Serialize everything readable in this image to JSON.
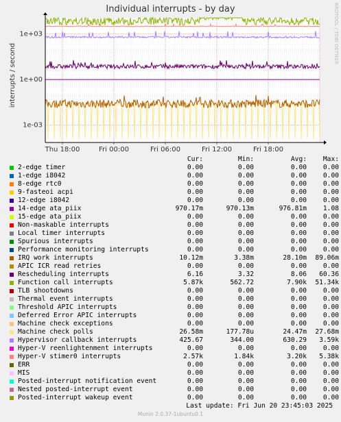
{
  "chart_data": {
    "type": "line",
    "title": "Individual interrupts - by day",
    "ylabel": "interrupts / second",
    "yscale": "log",
    "yticks": [
      "1e+03",
      "1e+00",
      "1e-03"
    ],
    "xticks": [
      "Thu 18:00",
      "Fri 00:00",
      "Fri 06:00",
      "Fri 12:00",
      "Fri 18:00"
    ],
    "grid": true,
    "columns": [
      "Cur:",
      "Min:",
      "Avg:",
      "Max:"
    ],
    "series": [
      {
        "name": "2-edge      timer",
        "color": "#00cc00",
        "cur": "0.00",
        "min": "0.00",
        "avg": "0.00",
        "max": "0.00"
      },
      {
        "name": "1-edge      i8042",
        "color": "#0066b3",
        "cur": "0.00",
        "min": "0.00",
        "avg": "0.00",
        "max": "0.00"
      },
      {
        "name": "8-edge      rtc0",
        "color": "#ff8000",
        "cur": "0.00",
        "min": "0.00",
        "avg": "0.00",
        "max": "0.00"
      },
      {
        "name": "9-fasteoi   acpi",
        "color": "#ffcc00",
        "cur": "0.00",
        "min": "0.00",
        "avg": "0.00",
        "max": "0.00"
      },
      {
        "name": "12-edge      i8042",
        "color": "#330099",
        "cur": "0.00",
        "min": "0.00",
        "avg": "0.00",
        "max": "0.00"
      },
      {
        "name": "14-edge      ata_piix",
        "color": "#990099",
        "cur": "970.17m",
        "min": "970.13m",
        "avg": "976.81m",
        "max": "1.08"
      },
      {
        "name": "15-edge      ata_piix",
        "color": "#ccff00",
        "cur": "0.00",
        "min": "0.00",
        "avg": "0.00",
        "max": "0.00"
      },
      {
        "name": "Non-maskable interrupts",
        "color": "#ff0000",
        "cur": "0.00",
        "min": "0.00",
        "avg": "0.00",
        "max": "0.00"
      },
      {
        "name": "Local timer interrupts",
        "color": "#808080",
        "cur": "0.00",
        "min": "0.00",
        "avg": "0.00",
        "max": "0.00"
      },
      {
        "name": "Spurious interrupts",
        "color": "#008f00",
        "cur": "0.00",
        "min": "0.00",
        "avg": "0.00",
        "max": "0.00"
      },
      {
        "name": "Performance monitoring interrupts",
        "color": "#00487d",
        "cur": "0.00",
        "min": "0.00",
        "avg": "0.00",
        "max": "0.00"
      },
      {
        "name": "IRQ work interrupts",
        "color": "#b35a00",
        "cur": "10.12m",
        "min": "3.38m",
        "avg": "28.10m",
        "max": "89.06m"
      },
      {
        "name": "APIC ICR read retries",
        "color": "#b38f00",
        "cur": "0.00",
        "min": "0.00",
        "avg": "0.00",
        "max": "0.00"
      },
      {
        "name": "Rescheduling interrupts",
        "color": "#6b006b",
        "cur": "6.16",
        "min": "3.32",
        "avg": "8.06",
        "max": "60.36"
      },
      {
        "name": "Function call interrupts",
        "color": "#8fb300",
        "cur": "5.87k",
        "min": "562.72",
        "avg": "7.90k",
        "max": "51.34k"
      },
      {
        "name": "TLB shootdowns",
        "color": "#b30000",
        "cur": "0.00",
        "min": "0.00",
        "avg": "0.00",
        "max": "0.00"
      },
      {
        "name": "Thermal event interrupts",
        "color": "#bebebe",
        "cur": "0.00",
        "min": "0.00",
        "avg": "0.00",
        "max": "0.00"
      },
      {
        "name": "Threshold APIC interrupts",
        "color": "#80ff80",
        "cur": "0.00",
        "min": "0.00",
        "avg": "0.00",
        "max": "0.00"
      },
      {
        "name": "Deferred Error APIC interrupts",
        "color": "#80c9ff",
        "cur": "0.00",
        "min": "0.00",
        "avg": "0.00",
        "max": "0.00"
      },
      {
        "name": "Machine check exceptions",
        "color": "#ffc080",
        "cur": "0.00",
        "min": "0.00",
        "avg": "0.00",
        "max": "0.00"
      },
      {
        "name": "Machine check polls",
        "color": "#ffe680",
        "cur": "26.58m",
        "min": "177.78u",
        "avg": "24.47m",
        "max": "27.68m"
      },
      {
        "name": "Hypervisor callback interrupts",
        "color": "#aa80ff",
        "cur": "425.67",
        "min": "344.00",
        "avg": "630.29",
        "max": "3.59k"
      },
      {
        "name": "Hyper-V reenlightenment interrupts",
        "color": "#ee00cc",
        "cur": "0.00",
        "min": "0.00",
        "avg": "0.00",
        "max": "0.00"
      },
      {
        "name": "Hyper-V stimer0 interrupts",
        "color": "#ff8080",
        "cur": "2.57k",
        "min": "1.84k",
        "avg": "3.20k",
        "max": "5.38k"
      },
      {
        "name": "ERR",
        "color": "#666600",
        "cur": "0.00",
        "min": "0.00",
        "avg": "0.00",
        "max": "0.00"
      },
      {
        "name": "MIS",
        "color": "#ffbfff",
        "cur": "0.00",
        "min": "0.00",
        "avg": "0.00",
        "max": "0.00"
      },
      {
        "name": "Posted-interrupt notification event",
        "color": "#00ffcc",
        "cur": "0.00",
        "min": "0.00",
        "avg": "0.00",
        "max": "0.00"
      },
      {
        "name": "Nested posted-interrupt event",
        "color": "#cc6699",
        "cur": "0.00",
        "min": "0.00",
        "avg": "0.00",
        "max": "0.00"
      },
      {
        "name": "Posted-interrupt wakeup event",
        "color": "#999900",
        "cur": "0.00",
        "min": "0.00",
        "avg": "0.00",
        "max": "0.00"
      }
    ]
  },
  "footer": {
    "last_update": "Last update: Fri Jun 20 23:45:03 2025",
    "generator": "Munin 2.0.37-1ubuntu0.1",
    "side_text": "RRDTOOL / TOBI OETIKER"
  }
}
